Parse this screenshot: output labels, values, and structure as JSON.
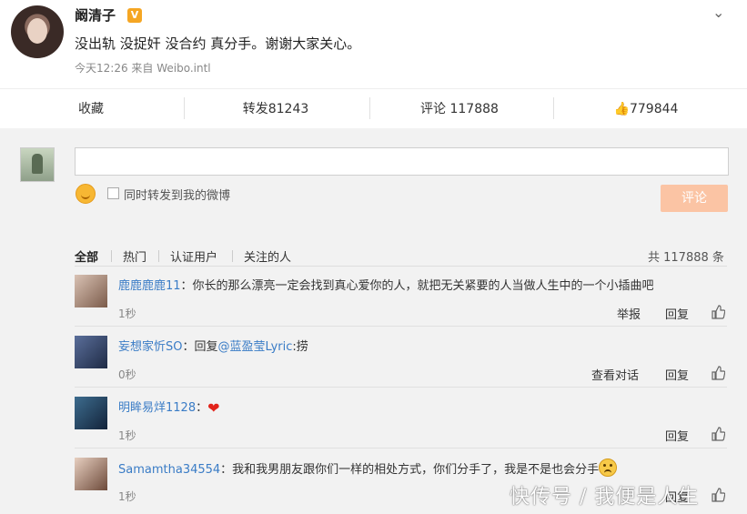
{
  "post": {
    "author": "阚清子",
    "badge": "V",
    "content": "没出轨 没捉奸 没合约 真分手。谢谢大家关心。",
    "meta": "今天12:26 来自 Weibo.intl"
  },
  "actions": {
    "favorite": "收藏",
    "repost": "转发81243",
    "comment": "评论 117888",
    "like": "779844"
  },
  "composer": {
    "placeholder": "",
    "forward_label": "同时转发到我的微博",
    "submit": "评论"
  },
  "tabs": {
    "items": [
      "全部",
      "热门",
      "认证用户",
      "关注的人"
    ],
    "total": "共 117888 条"
  },
  "comments": [
    {
      "user": "鹿鹿鹿鹿11",
      "text": "：你长的那么漂亮一定会找到真心爱你的人，就把无关紧要的人当做人生中的一个小插曲吧",
      "time": "1秒",
      "actions": [
        "举报",
        "回复"
      ]
    },
    {
      "user": "妄想家忻SO",
      "pre": "：回复",
      "mention": "@蓝盈莹Lyric",
      "text": ":捞",
      "time": "0秒",
      "actions": [
        "查看对话",
        "回复"
      ]
    },
    {
      "user": "明眸易烊1128",
      "text": "：",
      "time": "1秒",
      "actions": [
        "回复"
      ]
    },
    {
      "user": "Samamtha34554",
      "text": "：我和我男朋友跟你们一样的相处方式，你们分手了，我是不是也会分手",
      "time": "1秒",
      "actions": [
        "回复"
      ]
    }
  ],
  "watermark": "快传号 / 我便是人生"
}
